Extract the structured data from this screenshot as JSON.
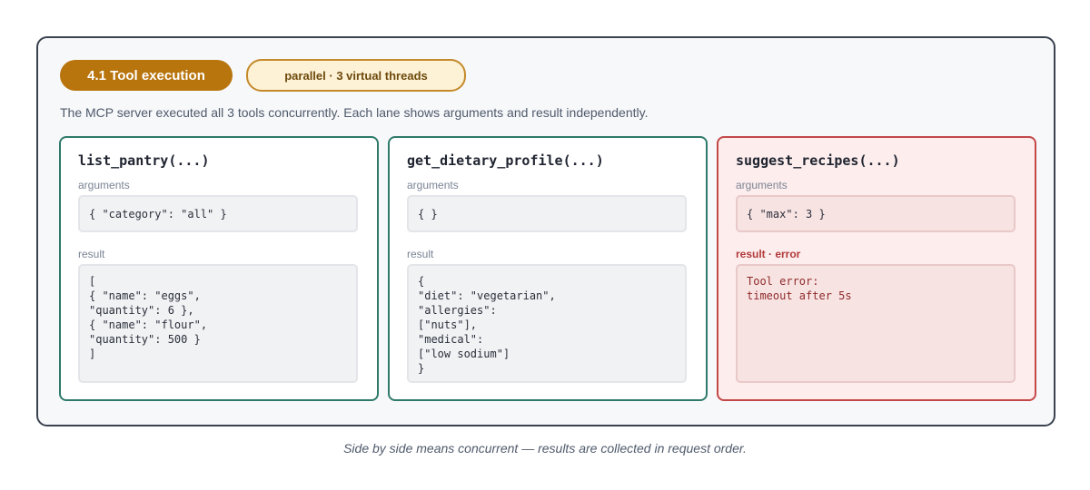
{
  "header": {
    "section_label": "4.1 Tool execution",
    "mode_label": "parallel · 3 virtual threads"
  },
  "description": "The MCP server executed all 3 tools concurrently. Each lane shows arguments and result independently.",
  "lanes": [
    {
      "title": "list_pantry(...)",
      "arguments_label": "arguments",
      "arguments": "{ \"category\": \"all\" }",
      "result_label": "result",
      "result": "[\n{ \"name\": \"eggs\",\n\"quantity\": 6 },\n{ \"name\": \"flour\",\n\"quantity\": 500 }\n]",
      "status": "ok",
      "border_color": "#2f7a6a"
    },
    {
      "title": "get_dietary_profile(...)",
      "arguments_label": "arguments",
      "arguments": "{ }",
      "result_label": "result",
      "result": "{\n\"diet\": \"vegetarian\",\n\"allergies\":\n[\"nuts\"],\n\"medical\":\n[\"low sodium\"]\n}",
      "status": "ok",
      "border_color": "#2f7a6a"
    },
    {
      "title": "suggest_recipes(...)",
      "arguments_label": "arguments",
      "arguments": "{ \"max\": 3 }",
      "result_label": "result · error",
      "result": "Tool error:\ntimeout after 5s",
      "status": "error",
      "border_color": "#c44848"
    }
  ],
  "caption": "Side by side means concurrent — results are collected in request order.",
  "colors": {
    "accent": "#b8740d",
    "ok": "#2f7a6a",
    "error": "#c44848"
  }
}
